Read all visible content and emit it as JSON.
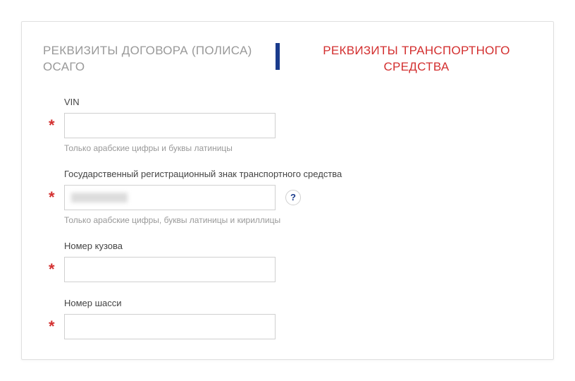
{
  "tabs": {
    "left": "РЕКВИЗИТЫ ДОГОВОРА (ПОЛИСА) ОСАГО",
    "right": "РЕКВИЗИТЫ ТРАНСПОРТНОГО СРЕДСТВА"
  },
  "fields": {
    "vin": {
      "label": "VIN",
      "value": "",
      "hint": "Только арабские цифры и буквы латиницы",
      "required_mark": "*"
    },
    "reg_plate": {
      "label": "Государственный регистрационный знак транспортного средства",
      "value": "",
      "hint": "Только арабские цифры, буквы латиницы и кириллицы",
      "required_mark": "*",
      "help": "?"
    },
    "body_number": {
      "label": "Номер кузова",
      "value": "",
      "required_mark": "*"
    },
    "chassis_number": {
      "label": "Номер шасси",
      "value": "",
      "required_mark": "*"
    }
  }
}
